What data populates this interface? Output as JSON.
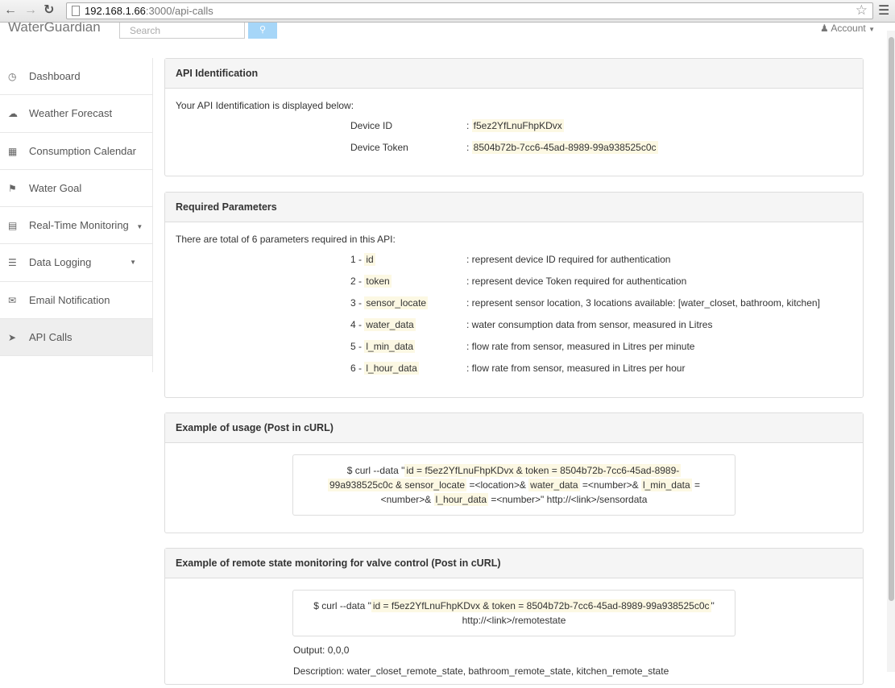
{
  "browser": {
    "url_host": "192.168.1.66",
    "url_path": ":3000/api-calls"
  },
  "navbar": {
    "brand": "WaterGuardian",
    "search_placeholder": "Search",
    "account_label": "Account"
  },
  "sidebar": {
    "items": [
      {
        "label": "Dashboard",
        "icon": "clock-icon"
      },
      {
        "label": "Weather Forecast",
        "icon": "cloud-icon"
      },
      {
        "label": "Consumption Calendar",
        "icon": "calendar-icon"
      },
      {
        "label": "Water Goal",
        "icon": "flag-icon"
      },
      {
        "label": "Real-Time Monitoring",
        "icon": "monitor-icon"
      },
      {
        "label": "Data Logging",
        "icon": "list-icon"
      },
      {
        "label": "Email Notification",
        "icon": "envelope-icon"
      },
      {
        "label": "API Calls",
        "icon": "send-icon"
      }
    ]
  },
  "api_identification": {
    "title": "API Identification",
    "intro": "Your API Identification is displayed below:",
    "rows": [
      {
        "key": "Device ID",
        "value": "f5ez2YfLnuFhpKDvx"
      },
      {
        "key": "Device Token",
        "value": "8504b72b-7cc6-45ad-8989-99a938525c0c"
      }
    ]
  },
  "required_parameters": {
    "title": "Required Parameters",
    "intro": "There are total of 6 parameters required in this API:",
    "params": [
      {
        "num": "1 -",
        "name": "id",
        "desc": ": represent device ID required for authentication"
      },
      {
        "num": "2 -",
        "name": "token",
        "desc": ": represent device Token required for authentication"
      },
      {
        "num": "3 -",
        "name": "sensor_locate",
        "desc": ": represent sensor location, 3 locations available: [water_closet, bathroom, kitchen]"
      },
      {
        "num": "4 -",
        "name": "water_data",
        "desc": ": water consumption data from sensor, measured in Litres"
      },
      {
        "num": "5 -",
        "name": "l_min_data",
        "desc": ": flow rate from sensor, measured in Litres per minute"
      },
      {
        "num": "6 -",
        "name": "l_hour_data",
        "desc": ": flow rate from sensor, measured in Litres per hour"
      }
    ]
  },
  "usage_example": {
    "title": "Example of usage (Post in cURL)",
    "line1_prefix": "$ curl --data \"",
    "line1_hl": "id = f5ez2YfLnuFhpKDvx & token = 8504b72b-7cc6-45ad-8989-",
    "line2_hl_a": "99a938525c0c & sensor_locate",
    "line2_mid": " =<location>& ",
    "line2_hl_b": "water_data",
    "line2_mid2": " =<number>& ",
    "line2_hl_c": "l_min_data",
    "line2_suffix": " =",
    "line3_prefix": "<number>& ",
    "line3_hl": "l_hour_data",
    "line3_suffix": " =<number>\" http://<link>/sensordata"
  },
  "remote_example": {
    "title": "Example of remote state monitoring for valve control (Post in cURL)",
    "line1_prefix": "$ curl --data \"",
    "line1_hl": "id = f5ez2YfLnuFhpKDvx & token = 8504b72b-7cc6-45ad-8989-99a938525c0c",
    "line1_suffix": "\"",
    "line2": "http://<link>/remotestate",
    "output": "Output: 0,0,0",
    "description": "Description: water_closet_remote_state, bathroom_remote_state, kitchen_remote_state"
  }
}
